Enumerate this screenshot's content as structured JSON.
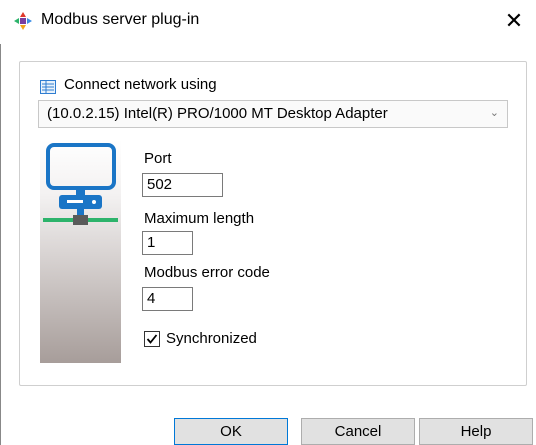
{
  "window": {
    "title": "Modbus server plug-in",
    "close_glyph": "✕"
  },
  "network": {
    "label": "Connect network using",
    "adapter_selected": "(10.0.2.15) Intel(R) PRO/1000 MT Desktop Adapter",
    "chevron_glyph": "⌄"
  },
  "fields": {
    "port_label": "Port",
    "port_value": "502",
    "max_length_label": "Maximum length",
    "max_length_value": "1",
    "error_code_label": "Modbus error code",
    "error_code_value": "4"
  },
  "options": {
    "synchronized_label": "Synchronized",
    "synchronized_checked": true
  },
  "buttons": {
    "ok": "OK",
    "cancel": "Cancel",
    "help": "Help"
  },
  "colors": {
    "monitor_blue": "#1a75c6",
    "network_green": "#2db36b",
    "illustration_top": "#ffffff",
    "illustration_bottom": "#a79d9a",
    "focus_blue": "#0078d7"
  }
}
